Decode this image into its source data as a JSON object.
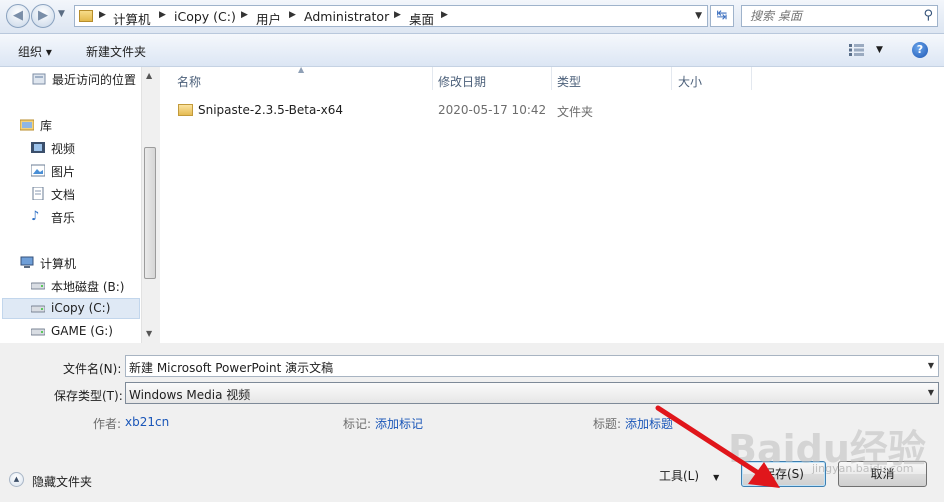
{
  "address_bar": {
    "breadcrumbs": [
      "计算机",
      "iCopy (C:)",
      "用户",
      "Administrator",
      "桌面"
    ],
    "search_placeholder": "搜索 桌面"
  },
  "toolbar": {
    "organize_label": "组织 ▾",
    "new_folder_label": "新建文件夹"
  },
  "nav_pane": {
    "items": [
      {
        "label": "最近访问的位置",
        "icon": "recent-places-icon"
      },
      {
        "label": "库",
        "icon": "library-icon"
      },
      {
        "label": "视频",
        "icon": "video-icon"
      },
      {
        "label": "图片",
        "icon": "pictures-icon"
      },
      {
        "label": "文档",
        "icon": "documents-icon"
      },
      {
        "label": "音乐",
        "icon": "music-icon"
      },
      {
        "label": "计算机",
        "icon": "computer-icon"
      },
      {
        "label": "本地磁盘 (B:)",
        "icon": "drive-icon"
      },
      {
        "label": "iCopy (C:)",
        "icon": "drive-icon",
        "selected": true
      },
      {
        "label": "GAME (G:)",
        "icon": "drive-icon"
      }
    ]
  },
  "file_list": {
    "columns": [
      "名称",
      "修改日期",
      "类型",
      "大小"
    ],
    "rows": [
      {
        "name": "Snipaste-2.3.5-Beta-x64",
        "modified": "2020-05-17 10:42",
        "type": "文件夹",
        "size": ""
      }
    ]
  },
  "form": {
    "filename_label": "文件名(N):",
    "filename_value": "新建 Microsoft PowerPoint 演示文稿",
    "filetype_label": "保存类型(T):",
    "filetype_value": "Windows Media 视频",
    "author_label": "作者:",
    "author_value": "xb21cn",
    "tags_label": "标记:",
    "tags_value": "添加标记",
    "title_label": "标题:",
    "title_value": "添加标题"
  },
  "footer": {
    "hide_folders_label": "隐藏文件夹",
    "tools_label": "工具(L)",
    "save_label": "保存(S)",
    "cancel_label": "取消"
  },
  "watermark": {
    "text": "Baidu经验",
    "sub": "jingyan.baidu.com"
  },
  "colors": {
    "accent": "#1a56b8",
    "annotation_arrow": "#e0161b"
  }
}
